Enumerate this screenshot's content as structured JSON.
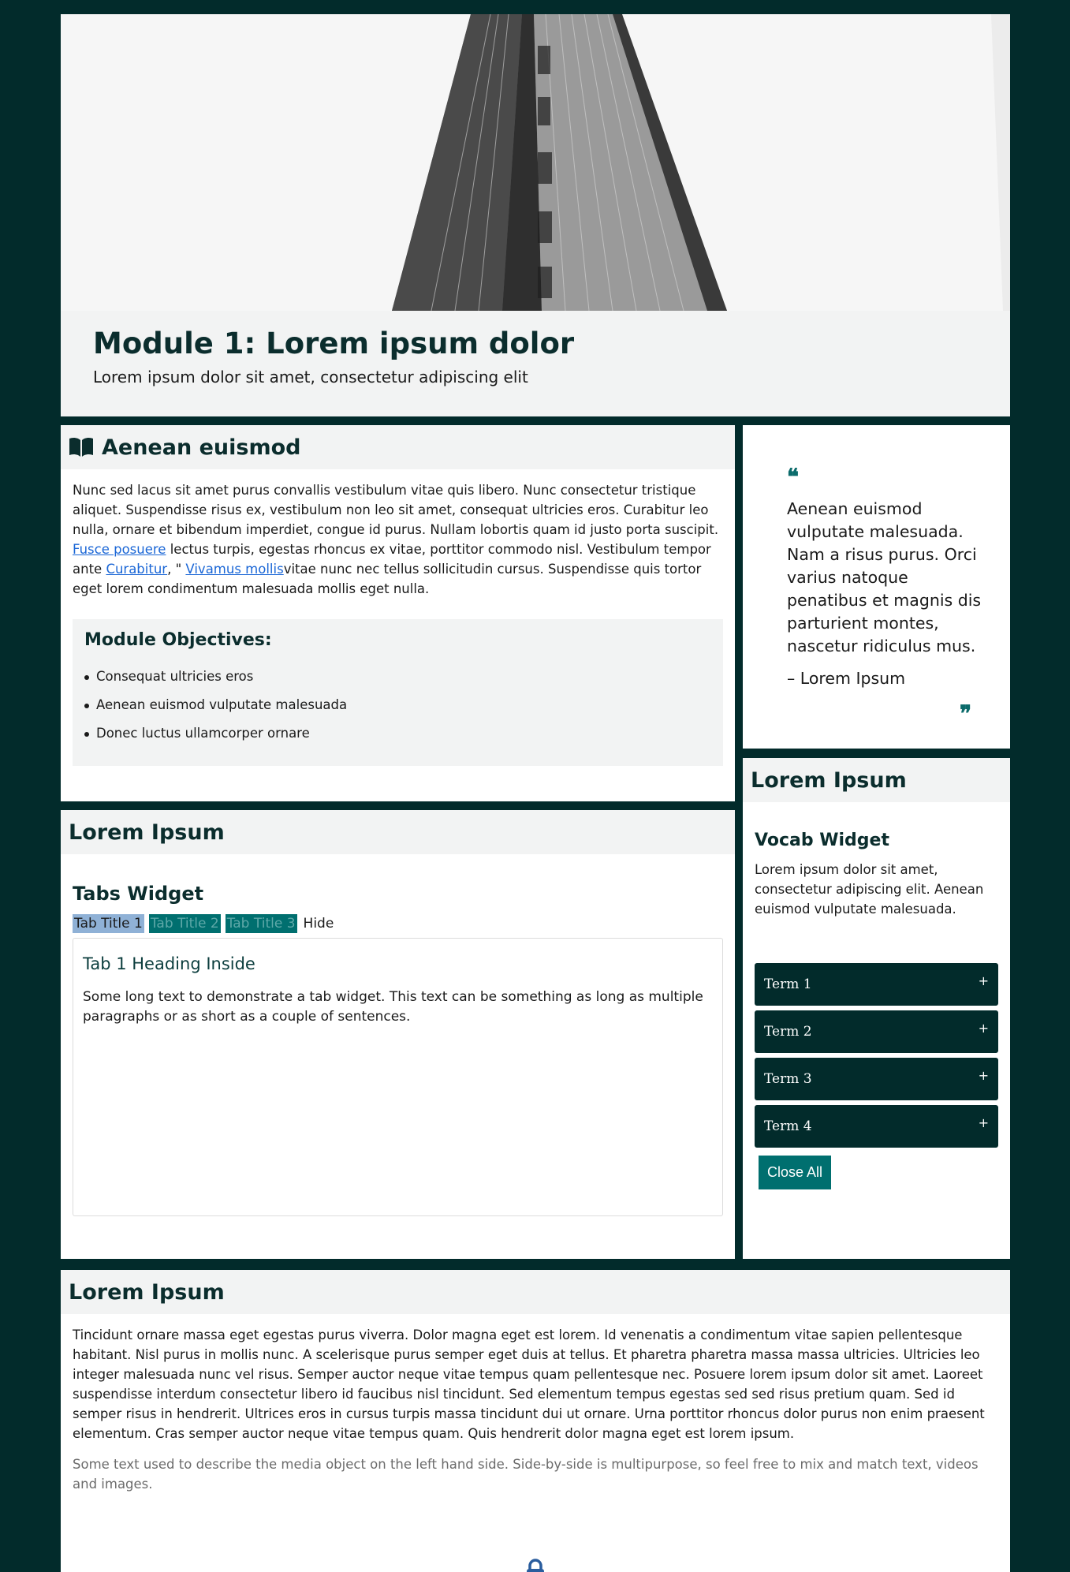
{
  "hero": {
    "image_alt": "flatiron-building-photo",
    "title": "Module 1: Lorem ipsum dolor",
    "subtitle": "Lorem ipsum dolor sit amet, consectetur adipiscing elit"
  },
  "intro": {
    "heading": "Aenean euismod",
    "icon": "book-open-icon",
    "text_1": "Nunc sed lacus sit amet purus convallis vestibulum vitae quis libero. Nunc consectetur tristique aliquet. Suspendisse risus ex, vestibulum non leo sit amet, consequat ultricies eros. Curabitur leo nulla, ornare et bibendum imperdiet, congue id purus. Nullam lobortis quam id justo porta suscipit. ",
    "link_1": "Fusce posuere",
    "text_2": " lectus turpis, egestas rhoncus ex vitae, porttitor commodo nisl. Vestibulum tempor ante ",
    "link_2": "Curabitur",
    "text_3": ", \" ",
    "link_3": "Vivamus mollis",
    "text_4": "vitae nunc nec tellus sollicitudin cursus. Suspendisse quis tortor eget lorem condimentum malesuada mollis eget nulla.",
    "objectives_heading": "Module Objectives:",
    "objectives": [
      "Consequat ultricies eros",
      "Aenean euismod vulputate malesuada",
      "Donec luctus ullamcorper ornare"
    ]
  },
  "quote": {
    "open_mark": "❝",
    "text": "Aenean euismod vulputate malesuada. Nam a risus purus. Orci varius natoque penatibus et magnis dis parturient montes, nascetur ridiculus mus.",
    "author": "– Lorem Ipsum",
    "close_mark": "❞"
  },
  "vocab": {
    "card_heading": "Lorem Ipsum",
    "heading": "Vocab Widget",
    "text": "Lorem ipsum dolor sit amet, consectetur adipiscing elit. Aenean euismod vulputate malesuada.",
    "terms": [
      "Term 1",
      "Term 2",
      "Term 3",
      "Term 4"
    ],
    "plus": "+",
    "close_all": "Close All"
  },
  "tabs": {
    "card_heading": "Lorem Ipsum",
    "heading": "Tabs Widget",
    "tab_labels": [
      "Tab Title 1",
      "Tab Title 2",
      "Tab Title 3"
    ],
    "hide_label": "Hide",
    "panel_heading": "Tab 1 Heading Inside",
    "panel_text": "Some long text to demonstrate a tab widget. This text can be something as long as multiple paragraphs or as short as a couple of sentences."
  },
  "bottom": {
    "card_heading": "Lorem Ipsum",
    "text": "Tincidunt ornare massa eget egestas purus viverra. Dolor magna eget est lorem. Id venenatis a condimentum vitae sapien pellentesque habitant. Nisl purus in mollis nunc. A scelerisque purus semper eget duis at tellus. Et pharetra pharetra massa massa ultricies. Ultricies leo integer malesuada nunc vel risus. Semper auctor neque vitae tempus quam pellentesque nec. Posuere lorem ipsum dolor sit amet. Laoreet suspendisse interdum consectetur libero id faucibus nisl tincidunt. Sed elementum tempus egestas sed sed risus pretium quam. Sed id semper risus in hendrerit. Ultrices eros in cursus turpis massa tincidunt dui ut ornare. Urna porttitor rhoncus dolor purus non enim praesent elementum. Cras semper auctor neque vitae tempus quam. Quis hendrerit dolor magna eget est lorem ipsum.",
    "caption": "Some text used to describe the media object on the left hand side. Side-by-side is multipurpose, so feel free to mix and match text, videos and images.",
    "icon": "lock-icon"
  },
  "colors": {
    "background": "#022b2b",
    "heading": "#0b2d2d",
    "accent": "#006f6f",
    "link": "#1a66d6",
    "active_tab": "#8fb1d6",
    "panel": "#f2f3f3"
  }
}
